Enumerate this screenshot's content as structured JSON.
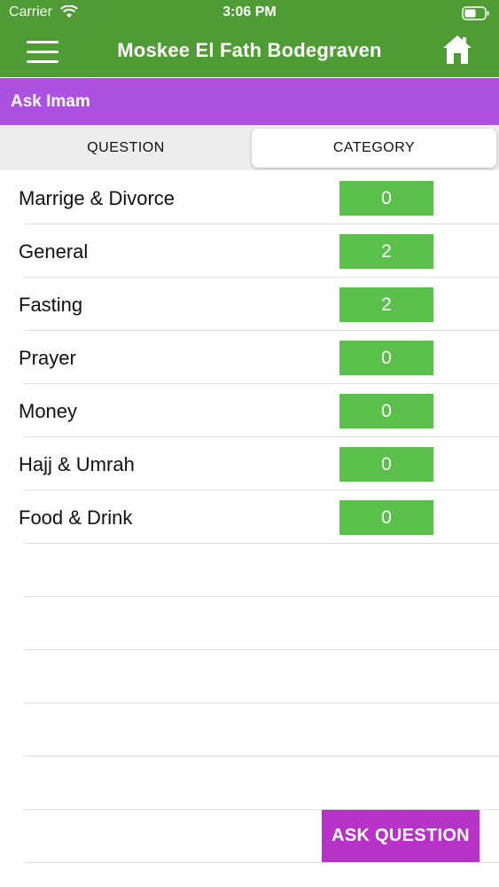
{
  "status_bar": {
    "carrier": "Carrier",
    "time": "3:06 PM"
  },
  "nav": {
    "title": "Moskee El Fath Bodegraven",
    "menu_icon": "hamburger-menu-icon",
    "home_icon": "home-icon"
  },
  "section": {
    "title": "Ask Imam"
  },
  "segments": [
    {
      "label": "QUESTION",
      "selected": false
    },
    {
      "label": "CATEGORY",
      "selected": true
    }
  ],
  "categories": [
    {
      "name": "Marrige & Divorce",
      "count": "0"
    },
    {
      "name": "General",
      "count": "2"
    },
    {
      "name": "Fasting",
      "count": "2"
    },
    {
      "name": "Prayer",
      "count": "0"
    },
    {
      "name": "Money",
      "count": "0"
    },
    {
      "name": "Hajj & Umrah",
      "count": "0"
    },
    {
      "name": "Food & Drink",
      "count": "0"
    }
  ],
  "ask_button": {
    "label": "ASK QUESTION"
  },
  "colors": {
    "nav_green": "#4f9b34",
    "header_purple": "#ad52e0",
    "count_green": "#5bbf4c",
    "button_purple": "#b733c7"
  }
}
